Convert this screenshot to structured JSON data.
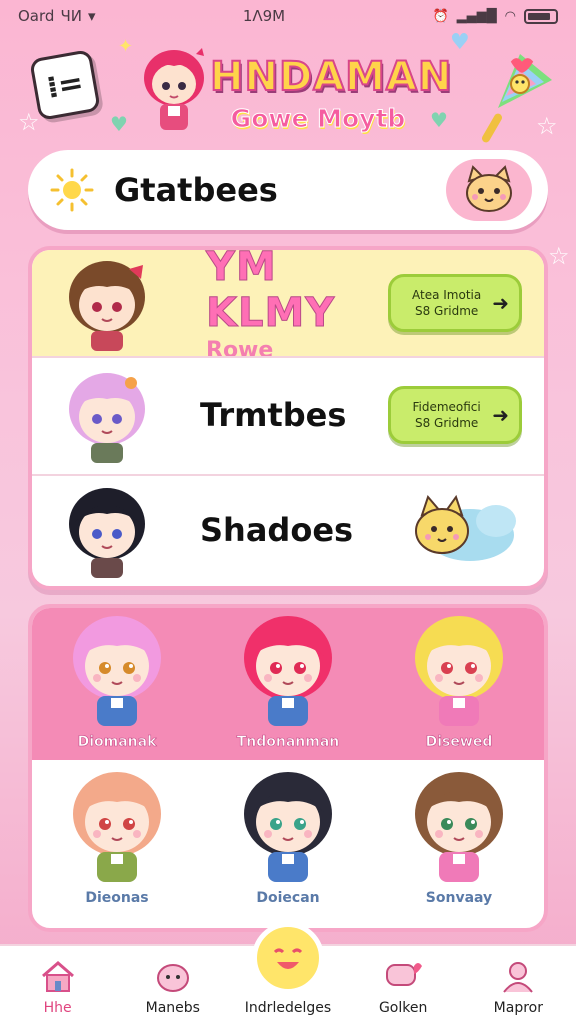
{
  "status_bar": {
    "carrier": "Oard",
    "signal_text": "ЧИ",
    "time": "1Λ9Μ"
  },
  "header": {
    "menu_icon_glyph": "⁞=",
    "title": "HNDAMAN",
    "subtitle": "Gowe Moytb"
  },
  "search_card": {
    "text": "Gtatbees"
  },
  "featured": {
    "title": "YM KLMY",
    "subtitle": "Rowe",
    "button": {
      "line1": "Atea Imotia",
      "line2": "S8 Gridme"
    }
  },
  "list_rows": [
    {
      "title": "Trmtbes",
      "button": {
        "line1": "Fidemeofici",
        "line2": "S8 Gridme"
      }
    },
    {
      "title": "Shadoes"
    }
  ],
  "characters": [
    {
      "label": "Diomanak",
      "hair": "#f29ae0",
      "eyes": "#d68a2a",
      "shirt": "#4a7bc9"
    },
    {
      "label": "Tndonanman",
      "hair": "#f0306a",
      "eyes": "#e02b55",
      "shirt": "#4a7bc9"
    },
    {
      "label": "Disewed",
      "hair": "#f6dc52",
      "eyes": "#d94050",
      "shirt": "#f07ab8"
    },
    {
      "label": "Dieonas",
      "hair": "#f3a98a",
      "eyes": "#d04545",
      "shirt": "#8aa84a"
    },
    {
      "label": "Doiecan",
      "hair": "#2a2a38",
      "eyes": "#3aa38a",
      "shirt": "#4a7bc9"
    },
    {
      "label": "Sonvaay",
      "hair": "#8a5a3a",
      "eyes": "#3a8a5a",
      "shirt": "#f07ab8"
    }
  ],
  "nav": [
    {
      "label": "Hhe",
      "icon": "home-icon",
      "active": true
    },
    {
      "label": "Manebs",
      "icon": "pet-icon",
      "active": false
    },
    {
      "label": "Indrledelges",
      "icon": "smile-icon",
      "active": false
    },
    {
      "label": "Golken",
      "icon": "chat-icon",
      "active": false
    },
    {
      "label": "Mapror",
      "icon": "profile-icon",
      "active": false
    }
  ],
  "colors": {
    "accent_pink": "#f48bb6",
    "card_border": "#f6a6c7",
    "button_green": "#c9ec6b",
    "hero_yellow": "#fdf2b8"
  }
}
